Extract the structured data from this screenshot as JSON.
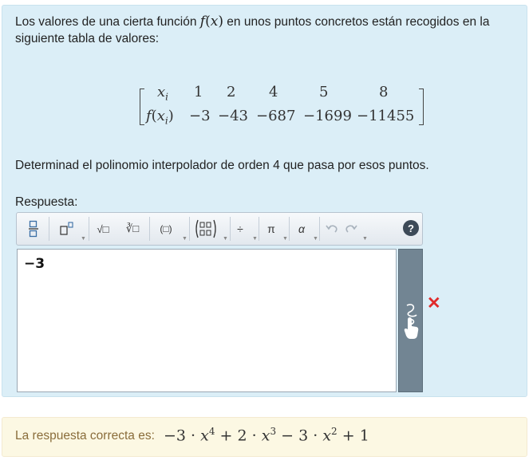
{
  "question": {
    "intro_before": "Los valores de una cierta función",
    "func": "f(x)",
    "intro_after": "en unos puntos concretos están recogidos en la siguiente tabla de valores:",
    "table": {
      "row1_label": "x",
      "row1_sub": "i",
      "row2_label_f": "f(x",
      "row2_sub": "i",
      "row2_close": ")",
      "xs": [
        "1",
        "2",
        "4",
        "5",
        "8"
      ],
      "fxs": [
        "−3",
        "−43",
        "−687",
        "−1699",
        "−11455"
      ]
    },
    "task": "Determinad el polinomio interpolador de orden 4 que pasa por esos puntos."
  },
  "response": {
    "label": "Respuesta:",
    "value": "−3",
    "status_icon": "incorrect-x-icon"
  },
  "toolbar": {
    "help": "?",
    "pi": "π",
    "alpha": "α",
    "divide": "÷",
    "paren": "(□)",
    "sqrt": "√□",
    "nroot": "∛□"
  },
  "answer": {
    "label": "La respuesta correcta es:",
    "terms": [
      {
        "coef": "−3",
        "var": "x",
        "exp": "4"
      },
      {
        "coef": "+ 2",
        "var": "x",
        "exp": "3"
      },
      {
        "coef": "− 3",
        "var": "x",
        "exp": "2"
      }
    ],
    "const": "+ 1"
  },
  "colors": {
    "question_bg": "#dbeef7",
    "answer_bg": "#fcf8e3",
    "answer_label": "#8a6d3b",
    "handpanel": "#728593",
    "error": "#e02b2b"
  }
}
